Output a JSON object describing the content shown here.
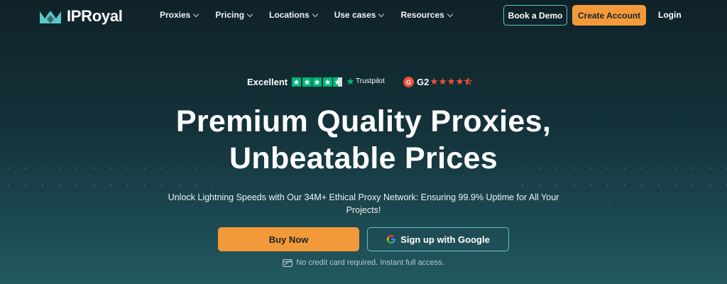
{
  "nav": {
    "logo_text": "IPRoyal",
    "menu": [
      {
        "label": "Proxies"
      },
      {
        "label": "Pricing"
      },
      {
        "label": "Locations"
      },
      {
        "label": "Use cases"
      },
      {
        "label": "Resources"
      }
    ],
    "book_demo": "Book a Demo",
    "create_account": "Create Account",
    "login": "Login"
  },
  "ratings": {
    "excellent": "Excellent",
    "trustpilot": "Trustpilot",
    "g2_badge": "G",
    "g2_label": "G2"
  },
  "hero": {
    "headline_line1": "Premium Quality Proxies,",
    "headline_line2": "Unbeatable Prices",
    "subtitle": "Unlock Lightning Speeds with Our 34M+ Ethical Proxy Network: Ensuring 99.9% Uptime for All Your Projects!",
    "buy_now": "Buy Now",
    "google_signup": "Sign up with Google",
    "note": "No credit card required. Instant full access."
  },
  "colors": {
    "accent_orange": "#f29a3a",
    "accent_teal": "#5ec7c9",
    "trustpilot_green": "#00b67a",
    "g2_red": "#ef4f37"
  },
  "icons": {
    "logo": "crown-logo-icon",
    "google": "google-g-icon",
    "card": "credit-card-icon"
  }
}
